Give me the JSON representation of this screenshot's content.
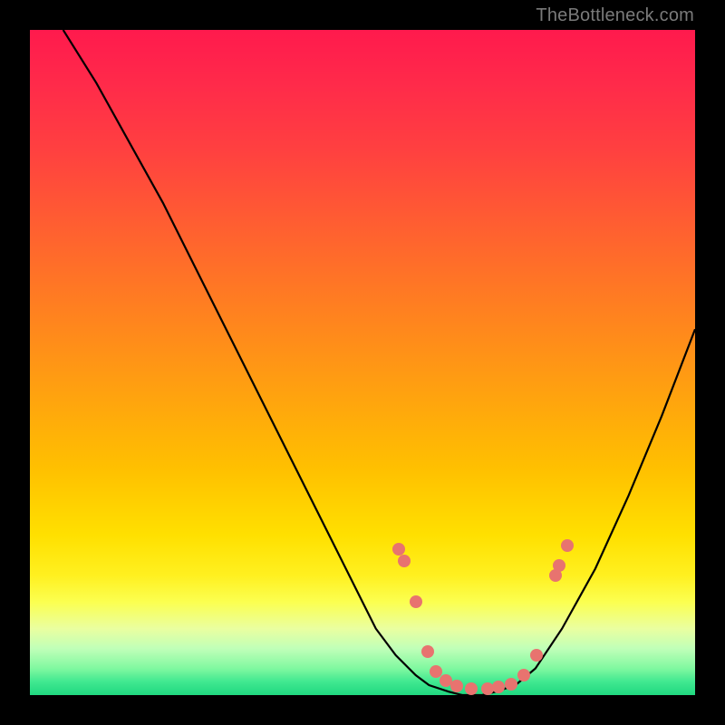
{
  "attribution": "TheBottleneck.com",
  "colors": {
    "dot": "#e8736f",
    "curve": "#000000",
    "frame": "#000000"
  },
  "chart_data": {
    "type": "line",
    "title": "",
    "xlabel": "",
    "ylabel": "",
    "xlim": [
      0,
      100
    ],
    "ylim": [
      0,
      100
    ],
    "series": [
      {
        "name": "bottleneck-curve",
        "x": [
          5,
          10,
          15,
          20,
          25,
          30,
          35,
          40,
          45,
          50,
          52,
          55,
          58,
          60,
          63,
          65,
          68,
          70,
          73,
          76,
          80,
          85,
          90,
          95,
          100
        ],
        "y": [
          100,
          92,
          83,
          74,
          64,
          54,
          44,
          34,
          24,
          14,
          10,
          6,
          3,
          1.5,
          0.5,
          0,
          0,
          0.5,
          1.5,
          4,
          10,
          19,
          30,
          42,
          55
        ]
      }
    ],
    "markers": {
      "name": "highlight-dots",
      "points": [
        {
          "x": 55.5,
          "y": 22.0
        },
        {
          "x": 56.3,
          "y": 20.2
        },
        {
          "x": 58.0,
          "y": 14.0
        },
        {
          "x": 59.8,
          "y": 6.5
        },
        {
          "x": 61.0,
          "y": 3.5
        },
        {
          "x": 62.5,
          "y": 2.2
        },
        {
          "x": 64.2,
          "y": 1.4
        },
        {
          "x": 66.4,
          "y": 1.0
        },
        {
          "x": 68.8,
          "y": 1.0
        },
        {
          "x": 70.5,
          "y": 1.2
        },
        {
          "x": 72.4,
          "y": 1.6
        },
        {
          "x": 74.3,
          "y": 3.0
        },
        {
          "x": 76.1,
          "y": 6.0
        },
        {
          "x": 79.0,
          "y": 18.0
        },
        {
          "x": 79.6,
          "y": 19.5
        },
        {
          "x": 80.8,
          "y": 22.5
        }
      ]
    }
  }
}
